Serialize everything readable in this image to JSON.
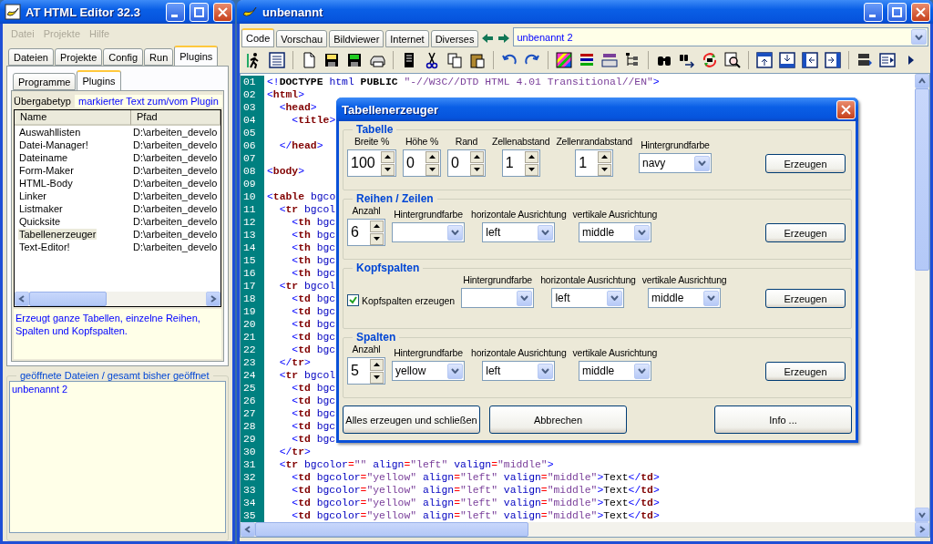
{
  "left_window": {
    "title": "AT HTML Editor 32.3",
    "menu": [
      {
        "label": "Datei",
        "disabled": true
      },
      {
        "label": "Projekte",
        "disabled": true
      },
      {
        "label": "Hilfe",
        "disabled": true
      }
    ],
    "tabs": [
      {
        "label": "Dateien",
        "selected": false
      },
      {
        "label": "Projekte",
        "selected": false
      },
      {
        "label": "Config",
        "selected": false
      },
      {
        "label": "Run",
        "selected": false
      },
      {
        "label": "Plugins",
        "selected": true
      }
    ],
    "subtabs": [
      {
        "label": "Programme",
        "selected": false
      },
      {
        "label": "Plugins",
        "selected": true
      }
    ],
    "transfer": {
      "label": "Übergabetyp",
      "value": "markierter Text zum/vom Plugin"
    },
    "plugin_table": {
      "columns": [
        "Name",
        "Pfad"
      ],
      "rows": [
        {
          "name": "Auswahllisten",
          "path": "D:\\arbeiten_develo",
          "selected": false
        },
        {
          "name": "Datei-Manager!",
          "path": "D:\\arbeiten_develo",
          "selected": false
        },
        {
          "name": "Dateiname",
          "path": "D:\\arbeiten_develo",
          "selected": false
        },
        {
          "name": "Form-Maker",
          "path": "D:\\arbeiten_develo",
          "selected": false
        },
        {
          "name": "HTML-Body",
          "path": "D:\\arbeiten_develo",
          "selected": false
        },
        {
          "name": "Linker",
          "path": "D:\\arbeiten_develo",
          "selected": false
        },
        {
          "name": "Listmaker",
          "path": "D:\\arbeiten_develo",
          "selected": false
        },
        {
          "name": "Quicksite",
          "path": "D:\\arbeiten_develo",
          "selected": false
        },
        {
          "name": "Tabellenerzeuger",
          "path": "D:\\arbeiten_develo",
          "selected": true
        },
        {
          "name": "Text-Editor!",
          "path": "D:\\arbeiten_develo",
          "selected": false
        }
      ]
    },
    "description": "Erzeugt ganze Tabellen, einzelne Reihen, Spalten und Kopfspalten.",
    "open_files": {
      "title": "geöffnete Dateien / gesamt bisher geöffnet",
      "items": [
        "unbenannt 2"
      ]
    }
  },
  "editor_window": {
    "title": "unbenannt",
    "tabs": [
      {
        "label": "Code",
        "selected": true
      },
      {
        "label": "Vorschau",
        "selected": false
      },
      {
        "label": "Bildviewer",
        "selected": false
      },
      {
        "label": "Internet",
        "selected": false
      },
      {
        "label": "Diverses",
        "selected": false
      }
    ],
    "document": "unbenannt 2",
    "lines": [
      {
        "number": "01",
        "text": "<!DOCTYPE html PUBLIC \"-//W3C//DTD HTML 4.01 Transitional//EN\">"
      },
      {
        "number": "02",
        "text": "<html>"
      },
      {
        "number": "03",
        "text": "  <head>"
      },
      {
        "number": "04",
        "text": "    <title>"
      },
      {
        "number": "05"
      },
      {
        "number": "06",
        "text": "  </head>"
      },
      {
        "number": "07"
      },
      {
        "number": "08",
        "text": "<body>"
      },
      {
        "number": "09"
      },
      {
        "number": "10",
        "text": "<table bgco"
      },
      {
        "number": "11",
        "text": "  <tr bgcol"
      },
      {
        "number": "12",
        "text": "    <th bgc"
      },
      {
        "number": "13",
        "text": "    <th bgc"
      },
      {
        "number": "14",
        "text": "    <th bgc"
      },
      {
        "number": "15",
        "text": "    <th bgc"
      },
      {
        "number": "16",
        "text": "    <th bgc"
      },
      {
        "number": "17",
        "text": "  <tr bgcol"
      },
      {
        "number": "18",
        "text": "    <td bgc"
      },
      {
        "number": "19",
        "text": "    <td bgc"
      },
      {
        "number": "20",
        "text": "    <td bgc"
      },
      {
        "number": "21",
        "text": "    <td bgc"
      },
      {
        "number": "22",
        "text": "    <td bgc"
      },
      {
        "number": "23",
        "text": "  </tr>"
      },
      {
        "number": "24",
        "text": "  <tr bgcol"
      },
      {
        "number": "25",
        "text": "    <td bgc"
      },
      {
        "number": "26",
        "text": "    <td bgc"
      },
      {
        "number": "27",
        "text": "    <td bgc"
      },
      {
        "number": "28",
        "text": "    <td bgc"
      },
      {
        "number": "29",
        "text": "    <td bgc"
      },
      {
        "number": "30",
        "text": "  </tr>"
      },
      {
        "number": "31",
        "text": "  <tr bgcolor=\"\" align=\"left\" valign=\"middle\">"
      },
      {
        "number": "32",
        "text": "    <td bgcolor=\"yellow\" align=\"left\" valign=\"middle\">Text</td>"
      },
      {
        "number": "33",
        "text": "    <td bgcolor=\"yellow\" align=\"left\" valign=\"middle\">Text</td>"
      },
      {
        "number": "34",
        "text": "    <td bgcolor=\"yellow\" align=\"left\" valign=\"middle\">Text</td>"
      },
      {
        "number": "35",
        "text": "    <td bgcolor=\"yellow\" align=\"left\" valign=\"middle\">Text</td>"
      }
    ]
  },
  "dialog": {
    "title": "Tabellenerzeuger",
    "sections": [
      {
        "title": "Tabelle",
        "button": "Erzeugen",
        "controls": [
          {
            "kind": "spinner",
            "label": "Breite %",
            "value": "100"
          },
          {
            "kind": "spinner",
            "label": "Höhe %",
            "value": "0"
          },
          {
            "kind": "spinner",
            "label": "Rand",
            "value": "0"
          },
          {
            "kind": "spinner",
            "label": "Zellenabstand",
            "value": "1"
          },
          {
            "kind": "spinner",
            "label": "Zellenrandabstand",
            "value": "1"
          },
          {
            "kind": "select",
            "label": "Hintergrundfarbe",
            "value": "navy"
          }
        ]
      },
      {
        "title": "Reihen / Zeilen",
        "button": "Erzeugen",
        "controls": [
          {
            "kind": "spinner",
            "label": "Anzahl",
            "value": "6"
          },
          {
            "kind": "select",
            "label": "Hintergrundfarbe"
          },
          {
            "kind": "select",
            "label": "horizontale Ausrichtung",
            "value": "left"
          },
          {
            "kind": "select",
            "label": "vertikale Ausrichtung",
            "value": "middle"
          }
        ]
      },
      {
        "title": "Kopfspalten",
        "button": "Erzeugen",
        "controls": [
          {
            "kind": "checkbox",
            "label": "Kopfspalten erzeugen",
            "checked": true
          },
          {
            "kind": "select",
            "label": "Hintergrundfarbe"
          },
          {
            "kind": "select",
            "label": "horizontale Ausrichtung",
            "value": "left"
          },
          {
            "kind": "select",
            "label": "vertikale Ausrichtung",
            "value": "middle"
          }
        ]
      },
      {
        "title": "Spalten",
        "button": "Erzeugen",
        "controls": [
          {
            "kind": "spinner",
            "label": "Anzahl",
            "value": "5"
          },
          {
            "kind": "select",
            "label": "Hintergrundfarbe",
            "value": "yellow"
          },
          {
            "kind": "select",
            "label": "horizontale Ausrichtung",
            "value": "left"
          },
          {
            "kind": "select",
            "label": "vertikale Ausrichtung",
            "value": "middle"
          }
        ]
      }
    ],
    "buttons": [
      "Alles erzeugen und schließen",
      "Abbrechen",
      "Info ..."
    ]
  }
}
